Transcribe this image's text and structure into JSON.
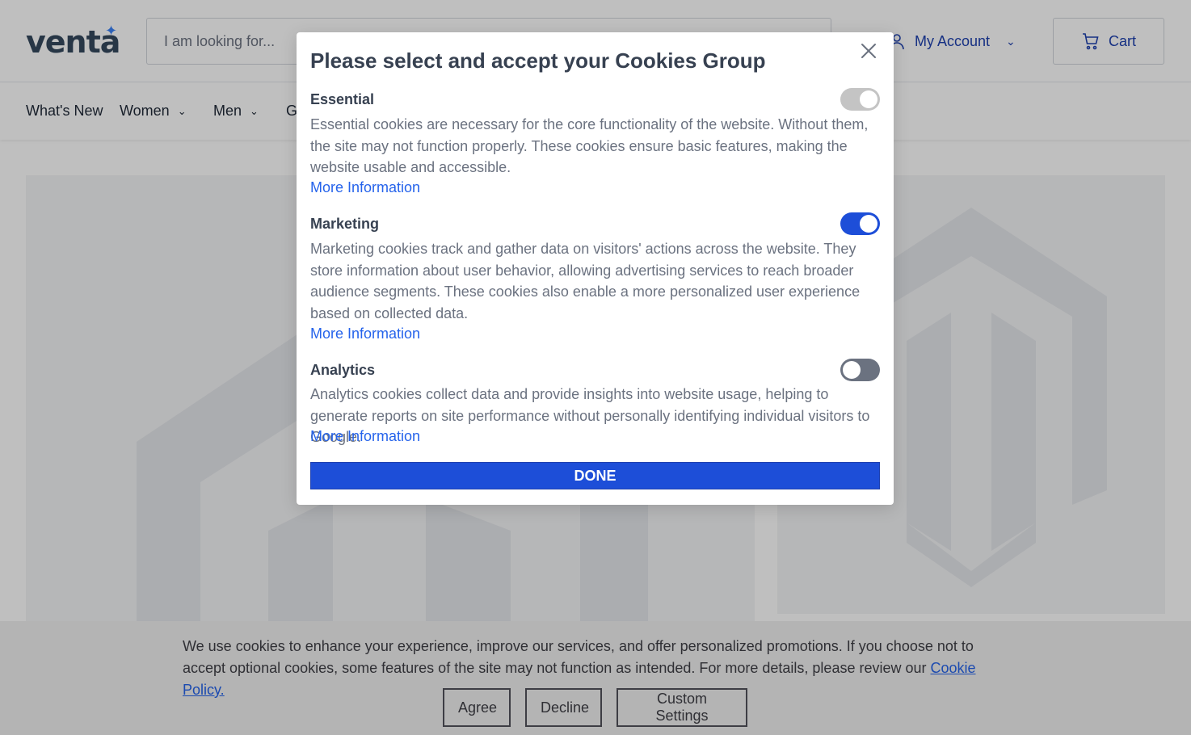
{
  "header": {
    "logo_text": "venta",
    "search_placeholder": "I am looking for...",
    "account_label": "My Account",
    "cart_label": "Cart"
  },
  "nav": {
    "items": [
      {
        "label": "What's New"
      },
      {
        "label": "Women"
      },
      {
        "label": "Men"
      },
      {
        "label": "G"
      }
    ]
  },
  "cookie_bar": {
    "text": "We use cookies to enhance your experience, improve our services, and offer personalized promotions. If you choose not to accept optional cookies, some features of the site may not function as intended. For more details, please review our ",
    "link_text": "Cookie Policy.",
    "agree_label": "Agree",
    "decline_label": "Decline",
    "custom_label": "Custom Settings"
  },
  "modal": {
    "title": "Please select and accept your Cookies Group",
    "sections": [
      {
        "title": "Essential",
        "description": "Essential cookies are necessary for the core functionality of the website. Without them, the site may not function properly. These cookies ensure basic features, making the website usable and accessible.",
        "link": "More Information",
        "enabled": true,
        "locked": true
      },
      {
        "title": "Marketing",
        "description": "Marketing cookies track and gather data on visitors' actions across the website. They store information about user behavior, allowing advertising services to reach broader audience segments. These cookies also enable a more personalized user experience based on collected data.",
        "link": "More Information",
        "enabled": true,
        "locked": false
      },
      {
        "title": "Analytics",
        "description": "Analytics cookies collect data and provide insights into website usage, helping to generate reports on site performance without personally identifying individual visitors to Google.",
        "link": "More Information",
        "enabled": false,
        "locked": false
      }
    ],
    "done_label": "DONE"
  },
  "colors": {
    "brand": "#1d4ed8",
    "link": "#2563eb"
  }
}
